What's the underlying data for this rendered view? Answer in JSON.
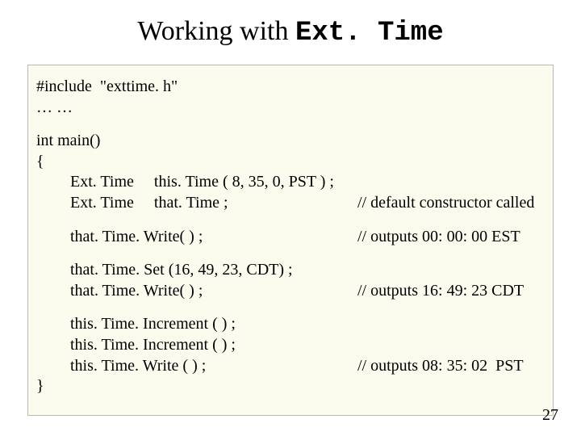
{
  "title": {
    "prefix": "Working with ",
    "mono": "Ext. Time"
  },
  "code": {
    "include": "#include  \"exttime. h\"",
    "ellipsis": "… …",
    "main_sig": "int main()",
    "open_brace": "{",
    "decl1": "Ext. Time     this. Time ( 8, 35, 0, PST ) ;",
    "decl2": "Ext. Time     that. Time ;",
    "comment_decl2": "// default constructor called",
    "write1": "that. Time. Write( ) ;",
    "comment_write1": "// outputs 00: 00: 00 EST",
    "set1": "that. Time. Set (16, 49, 23, CDT) ;",
    "write2": "that. Time. Write( ) ;",
    "comment_write2": "// outputs 16: 49: 23 CDT",
    "incr1": "this. Time. Increment ( ) ;",
    "incr2": "this. Time. Increment ( ) ;",
    "write3": "this. Time. Write ( ) ;",
    "comment_write3": "// outputs 08: 35: 02  PST",
    "close_brace": "}"
  },
  "page_number": "27"
}
